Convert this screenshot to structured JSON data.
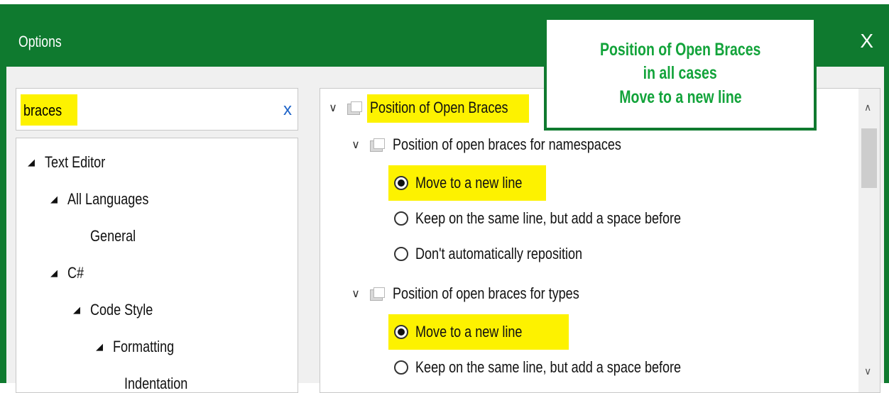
{
  "window": {
    "title": "Options",
    "close_glyph": "X"
  },
  "callout": {
    "lines": [
      "Position of Open Braces",
      "in all cases",
      "Move to a new line"
    ]
  },
  "search": {
    "value": "braces",
    "clear_glyph": "x"
  },
  "tree": {
    "items": [
      {
        "label": "Text Editor",
        "expanded": true
      },
      {
        "label": "All Languages",
        "expanded": true
      },
      {
        "label": "General",
        "expanded": false
      },
      {
        "label": "C#",
        "expanded": true
      },
      {
        "label": "Code Style",
        "expanded": true
      },
      {
        "label": "Formatting",
        "expanded": true
      },
      {
        "label": "Indentation",
        "expanded": false
      }
    ]
  },
  "settings": {
    "root": {
      "label": "Position of Open Braces"
    },
    "groups": [
      {
        "label": "Position of open braces for namespaces",
        "options": [
          {
            "label": "Move to a new line",
            "selected": true
          },
          {
            "label": "Keep on the same line, but add a space before",
            "selected": false
          },
          {
            "label": "Don't automatically reposition",
            "selected": false
          }
        ]
      },
      {
        "label": "Position of open braces for types",
        "options": [
          {
            "label": "Move to a new line",
            "selected": true
          },
          {
            "label": "Keep on the same line, but add a space before",
            "selected": false
          }
        ]
      }
    ]
  },
  "colors": {
    "accent": "#0f7a2f",
    "highlight": "#fdf200",
    "callout_text": "#12a33a"
  }
}
